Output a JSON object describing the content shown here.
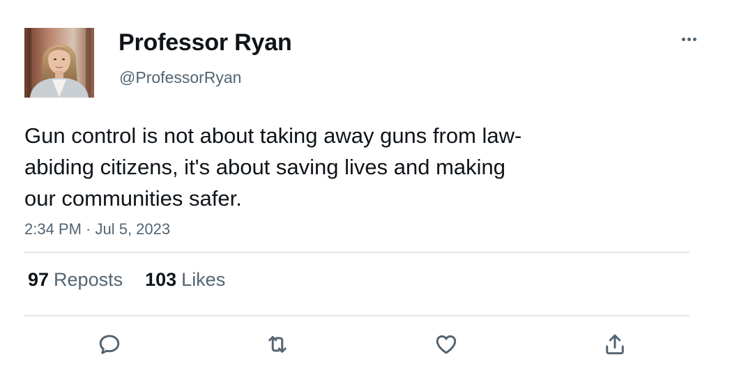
{
  "author": {
    "display_name": "Professor Ryan",
    "handle": "@ProfessorRyan",
    "avatar_alt": "Professor Ryan avatar"
  },
  "tweet": {
    "text": "Gun control is not about taking away guns from law-\nabiding citizens, it's about saving lives and making\nour communities safer.",
    "timestamp": "2:34 PM · Jul 5, 2023"
  },
  "stats": {
    "reposts_count": "97",
    "reposts_label": "Reposts",
    "likes_count": "103",
    "likes_label": "Likes"
  },
  "actions": {
    "reply_icon": "reply-icon",
    "repost_icon": "repost-icon",
    "like_icon": "heart-icon",
    "share_icon": "share-icon"
  },
  "colors": {
    "text_primary": "#0f1419",
    "text_secondary": "#536471",
    "divider": "#e1e5e8",
    "background": "#ffffff"
  }
}
